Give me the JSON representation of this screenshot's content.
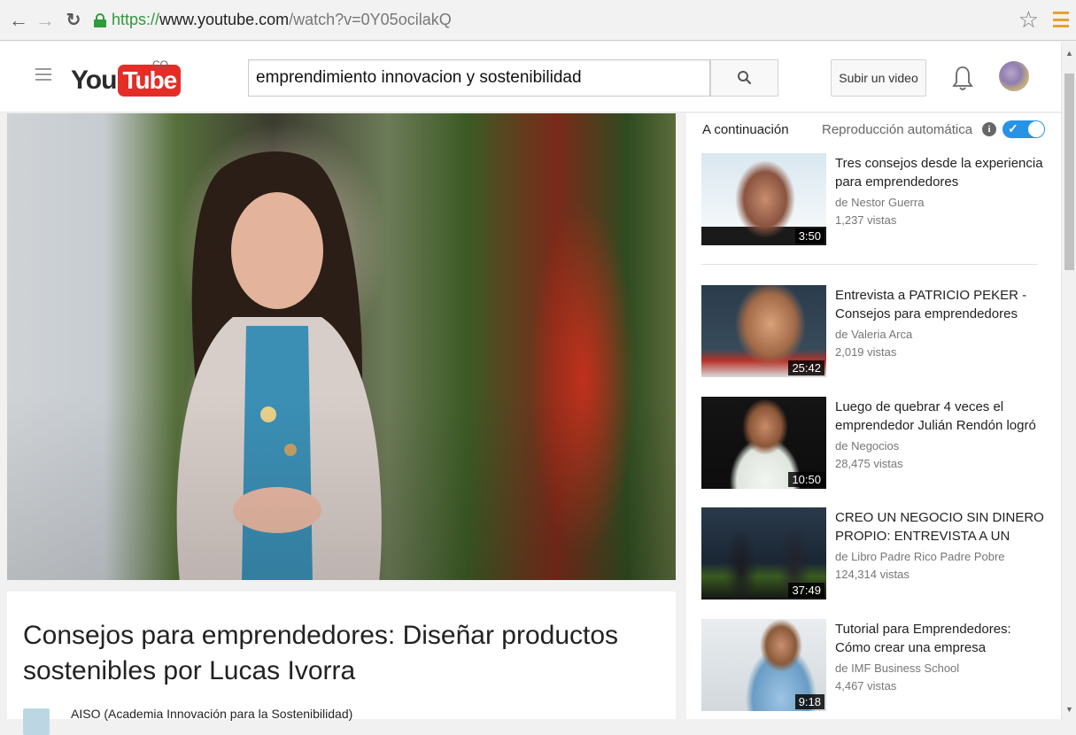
{
  "browser": {
    "url_scheme": "https://",
    "url_host": "www.youtube.com",
    "url_path": "/watch?v=0Y05ocilakQ"
  },
  "header": {
    "logo_you": "You",
    "logo_tube": "Tube",
    "country": "CO",
    "search_query": "emprendimiento innovacion y sostenibilidad",
    "upload_label": "Subir un video"
  },
  "video": {
    "title": "Consejos para emprendedores: Diseñar productos sostenibles por Lucas Ivorra",
    "channel": "AISO (Academia Innovación para la Sostenibilidad)"
  },
  "sidebar": {
    "up_next": "A continuación",
    "autoplay_label": "Reproducción automática",
    "info_glyph": "i",
    "items": [
      {
        "title": "Tres consejos desde la experiencia para emprendedores",
        "channel": "de Nestor Guerra",
        "views": "1,237 vistas",
        "duration": "3:50"
      },
      {
        "title": "Entrevista a PATRICIO PEKER - Consejos para emprendedores",
        "channel": "de Valeria Arca",
        "views": "2,019 vistas",
        "duration": "25:42"
      },
      {
        "title": "Luego de quebrar 4 veces el emprendedor Julián Rendón logró",
        "channel": "de Negocios",
        "views": "28,475 vistas",
        "duration": "10:50"
      },
      {
        "title": "CREO UN NEGOCIO SIN DINERO PROPIO: ENTREVISTA A UN",
        "channel": "de Libro Padre Rico Padre Pobre",
        "views": "124,314 vistas",
        "duration": "37:49"
      },
      {
        "title": "Tutorial para Emprendedores: Cómo crear una empresa",
        "channel": "de IMF Business School",
        "views": "4,467 vistas",
        "duration": "9:18"
      }
    ]
  },
  "colors": {
    "brand_red": "#e52d27",
    "toggle_blue": "#2793e6",
    "secure_green": "#2e9a3a"
  },
  "icons": {
    "back": "back-arrow-icon",
    "forward": "forward-arrow-icon",
    "reload": "reload-icon",
    "lock": "lock-icon",
    "bookmark": "star-icon",
    "browser_menu": "hamburger-menu-icon",
    "guide": "guide-menu-icon",
    "search": "search-icon",
    "notifications": "bell-icon",
    "info": "info-icon",
    "autoplay_check": "checkmark-icon"
  }
}
